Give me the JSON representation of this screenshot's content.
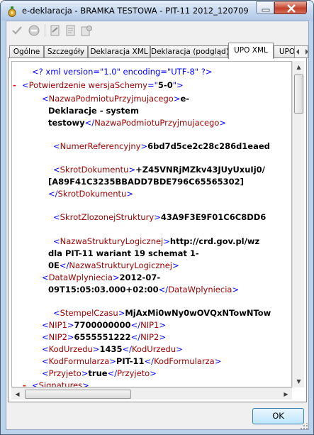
{
  "window": {
    "title": "e-deklaracja - BRAMKA TESTOWA - PIT-11 2012_120709...",
    "colors": {
      "frame": "#bcd3ec",
      "close_button": "#c5412b",
      "active_tab": "#ffffff"
    }
  },
  "toolbar": {
    "icons": [
      "check-icon",
      "block-icon",
      "sign-icon",
      "document-icon",
      "sign-document-icon"
    ]
  },
  "tabs": [
    {
      "label": "Ogólne",
      "active": false
    },
    {
      "label": "Szczegóły",
      "active": false
    },
    {
      "label": "Deklaracja XML",
      "active": false
    },
    {
      "label": "Deklaracja (podgląd)",
      "active": false
    },
    {
      "label": "UPO XML",
      "active": true
    },
    {
      "label": "UPO",
      "active": false
    }
  ],
  "xml": {
    "colors": {
      "markup": "#0000ff",
      "tag_name": "#990000",
      "value": "#000000",
      "toggle": "#ff0000"
    },
    "lines": [
      {
        "minus": "",
        "segments": [
          {
            "t": "<? xml version=\"1.0\" encoding=\"UTF-8\" ?>",
            "c": "b"
          }
        ]
      },
      {
        "minus": "-",
        "segments": [
          {
            "t": "<",
            "c": "b"
          },
          {
            "t": "Potwierdzenie wersjaSchemy",
            "c": "m"
          },
          {
            "t": "=\"",
            "c": "b"
          },
          {
            "t": "5-0",
            "c": "bold"
          },
          {
            "t": "\">",
            "c": "b"
          }
        ]
      },
      {
        "minus": "",
        "segments": [
          {
            "t": "<",
            "c": "b"
          },
          {
            "t": "NazwaPodmiotuPrzyjmujacego",
            "c": "m"
          },
          {
            "t": ">",
            "c": "b"
          },
          {
            "t": "e-",
            "c": "bold"
          }
        ]
      },
      {
        "minus": "",
        "segments": [
          {
            "t": "Deklaracje - system",
            "c": "bold"
          }
        ]
      },
      {
        "minus": "",
        "segments": [
          {
            "t": "testowy",
            "c": "bold"
          },
          {
            "t": "</",
            "c": "b"
          },
          {
            "t": "NazwaPodmiotuPrzyjmujacego",
            "c": "m"
          },
          {
            "t": ">",
            "c": "b"
          }
        ]
      },
      {
        "minus": "",
        "segments": [
          {
            "t": "<",
            "c": "b"
          },
          {
            "t": "NumerReferencyjny",
            "c": "m"
          },
          {
            "t": ">",
            "c": "b"
          },
          {
            "t": "6bd7d5ce2c28c286d1eaed",
            "c": "bold"
          }
        ]
      },
      {
        "minus": "",
        "segments": [
          {
            "t": "<",
            "c": "b"
          },
          {
            "t": "SkrotDokumentu",
            "c": "m"
          },
          {
            "t": ">",
            "c": "b"
          },
          {
            "t": "+Z45VNRjMZkv43JUyUxuIj0/",
            "c": "bold"
          }
        ]
      },
      {
        "minus": "",
        "segments": [
          {
            "t": "[A89F41C3235BBADD7BDE796C65565302]",
            "c": "bold"
          }
        ]
      },
      {
        "minus": "",
        "segments": [
          {
            "t": "</",
            "c": "b"
          },
          {
            "t": "SkrotDokumentu",
            "c": "m"
          },
          {
            "t": ">",
            "c": "b"
          }
        ]
      },
      {
        "minus": "",
        "segments": [
          {
            "t": "<",
            "c": "b"
          },
          {
            "t": "SkrotZlozonejStruktury",
            "c": "m"
          },
          {
            "t": ">",
            "c": "b"
          },
          {
            "t": "43A9F3E9F01C6C8DD6",
            "c": "bold"
          }
        ]
      },
      {
        "minus": "",
        "segments": [
          {
            "t": "<",
            "c": "b"
          },
          {
            "t": "NazwaStrukturyLogicznej",
            "c": "m"
          },
          {
            "t": ">",
            "c": "b"
          },
          {
            "t": "http://crd.gov.pl/wz",
            "c": "bold"
          }
        ]
      },
      {
        "minus": "",
        "segments": [
          {
            "t": "dla PIT-11 wariant 19 schemat 1-",
            "c": "bold"
          }
        ]
      },
      {
        "minus": "",
        "segments": [
          {
            "t": "0E",
            "c": "bold"
          },
          {
            "t": "</",
            "c": "b"
          },
          {
            "t": "NazwaStrukturyLogicznej",
            "c": "m"
          },
          {
            "t": ">",
            "c": "b"
          }
        ]
      },
      {
        "minus": "",
        "segments": [
          {
            "t": "<",
            "c": "b"
          },
          {
            "t": "DataWplyniecia",
            "c": "m"
          },
          {
            "t": ">",
            "c": "b"
          },
          {
            "t": "2012-07-",
            "c": "bold"
          }
        ]
      },
      {
        "minus": "",
        "segments": [
          {
            "t": "09T15:05:03.000+02:00",
            "c": "bold"
          },
          {
            "t": "</",
            "c": "b"
          },
          {
            "t": "DataWplyniecia",
            "c": "m"
          },
          {
            "t": ">",
            "c": "b"
          }
        ]
      },
      {
        "minus": "",
        "segments": [
          {
            "t": "<",
            "c": "b"
          },
          {
            "t": "StempelCzasu",
            "c": "m"
          },
          {
            "t": ">",
            "c": "b"
          },
          {
            "t": "MjAxMi0wNy0wOVQxNTowNTow",
            "c": "bold"
          }
        ]
      },
      {
        "minus": "",
        "segments": [
          {
            "t": "<",
            "c": "b"
          },
          {
            "t": "NIP1",
            "c": "m"
          },
          {
            "t": ">",
            "c": "b"
          },
          {
            "t": "7700000000",
            "c": "bold"
          },
          {
            "t": "</",
            "c": "b"
          },
          {
            "t": "NIP1",
            "c": "m"
          },
          {
            "t": ">",
            "c": "b"
          }
        ]
      },
      {
        "minus": "",
        "segments": [
          {
            "t": "<",
            "c": "b"
          },
          {
            "t": "NIP2",
            "c": "m"
          },
          {
            "t": ">",
            "c": "b"
          },
          {
            "t": "6555551222",
            "c": "bold"
          },
          {
            "t": "</",
            "c": "b"
          },
          {
            "t": "NIP2",
            "c": "m"
          },
          {
            "t": ">",
            "c": "b"
          }
        ]
      },
      {
        "minus": "",
        "segments": [
          {
            "t": "<",
            "c": "b"
          },
          {
            "t": "KodUrzedu",
            "c": "m"
          },
          {
            "t": ">",
            "c": "b"
          },
          {
            "t": "1435",
            "c": "bold"
          },
          {
            "t": "</",
            "c": "b"
          },
          {
            "t": "KodUrzedu",
            "c": "m"
          },
          {
            "t": ">",
            "c": "b"
          }
        ]
      },
      {
        "minus": "",
        "segments": [
          {
            "t": "<",
            "c": "b"
          },
          {
            "t": "KodFormularza",
            "c": "m"
          },
          {
            "t": ">",
            "c": "b"
          },
          {
            "t": "PIT-11",
            "c": "bold"
          },
          {
            "t": "</",
            "c": "b"
          },
          {
            "t": "KodFormularza",
            "c": "m"
          },
          {
            "t": ">",
            "c": "b"
          }
        ]
      },
      {
        "minus": "",
        "segments": [
          {
            "t": "<",
            "c": "b"
          },
          {
            "t": "Przyjeto",
            "c": "m"
          },
          {
            "t": ">",
            "c": "b"
          },
          {
            "t": "true",
            "c": "bold"
          },
          {
            "t": "</",
            "c": "b"
          },
          {
            "t": "Przyjeto",
            "c": "m"
          },
          {
            "t": ">",
            "c": "b"
          }
        ]
      },
      {
        "minus": "-",
        "segments": [
          {
            "t": "<",
            "c": "b"
          },
          {
            "t": "Signatures",
            "c": "m"
          },
          {
            "t": ">",
            "c": "b"
          }
        ]
      }
    ]
  },
  "buttons": {
    "ok_label": "OK"
  }
}
